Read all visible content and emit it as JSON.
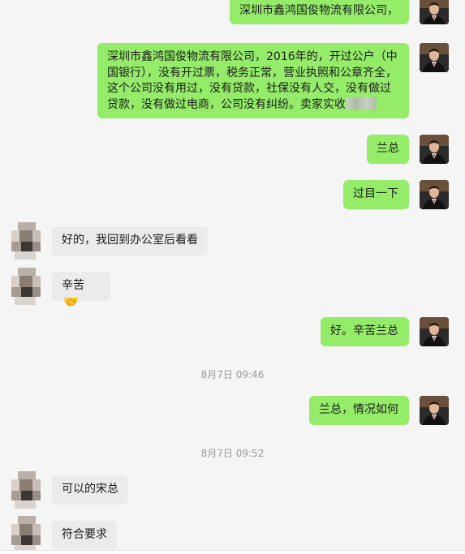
{
  "conversation": {
    "messages": [
      {
        "id": "m0",
        "dir": "out",
        "text": "深圳市鑫鸿国俊物流有限公司，"
      },
      {
        "id": "m1",
        "dir": "out",
        "text": "深圳市鑫鸿国俊物流有限公司，2016年的，开过公户（中国银行），没有开过票，税务正常，营业执照和公章齐全，这个公司没有用过，没有贷款，社保没有人交，没有做过贷款，没有做过电商，公司没有纠纷。卖家实收"
      },
      {
        "id": "m2",
        "dir": "out",
        "text": "兰总"
      },
      {
        "id": "m3",
        "dir": "out",
        "text": "过目一下"
      },
      {
        "id": "m4",
        "dir": "in",
        "text": "好的，我回到办公室后看看"
      },
      {
        "id": "m5",
        "dir": "in",
        "text": "辛苦"
      },
      {
        "id": "m6",
        "dir": "out",
        "text": "好。辛苦兰总"
      },
      {
        "id": "t1",
        "type": "time",
        "text": "8月7日 09:46"
      },
      {
        "id": "m7",
        "dir": "out",
        "text": "兰总，情况如何"
      },
      {
        "id": "t2",
        "type": "time",
        "text": "8月7日 09:52"
      },
      {
        "id": "m8",
        "dir": "in",
        "text": "可以的宋总"
      },
      {
        "id": "m9",
        "dir": "in",
        "text": "符合要求"
      }
    ]
  },
  "icons": {
    "handshake": "handshake-emoji",
    "out_avatar": "avatar-man-in-suit",
    "in_avatar": "avatar-pixelated"
  },
  "colors": {
    "outgoing_bubble": "#95ec69",
    "incoming_bubble": "#ebebeb",
    "background": "#f5f5f5",
    "timestamp": "#9a9a9a"
  }
}
